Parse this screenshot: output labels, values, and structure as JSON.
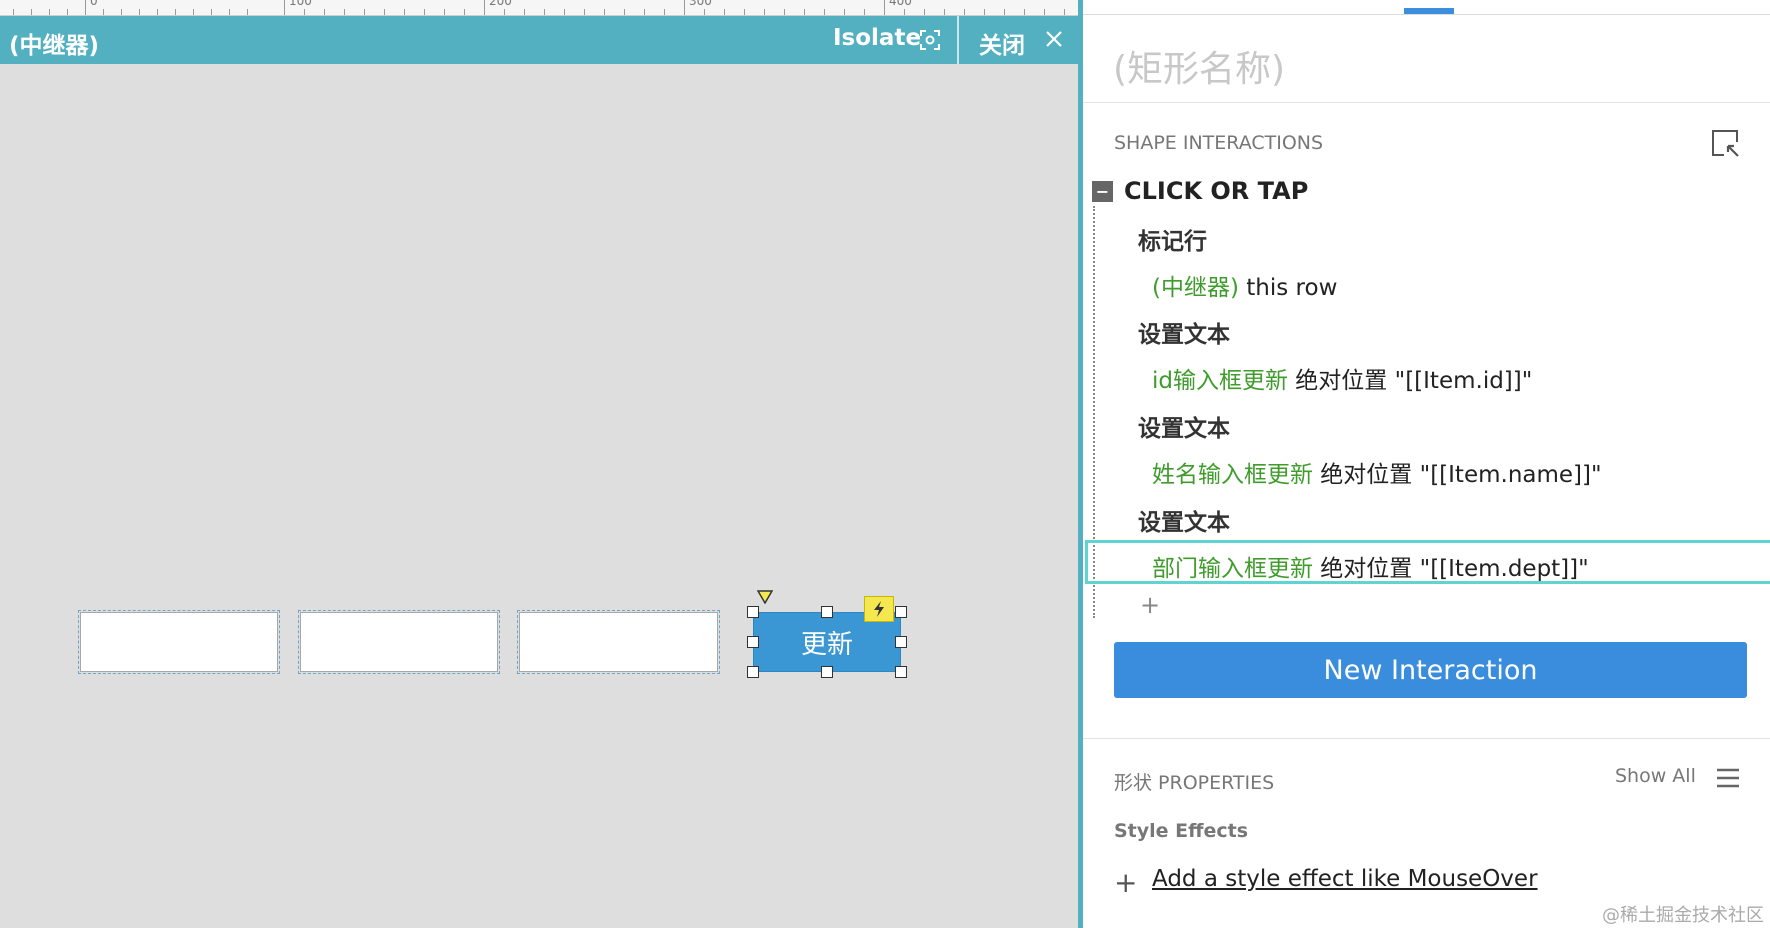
{
  "ruler": {
    "labels": [
      "0",
      "100",
      "200",
      "300",
      "400"
    ]
  },
  "repeater_bar": {
    "title": "(中继器)",
    "isolate_label": "Isolate",
    "close_label": "关闭"
  },
  "canvas": {
    "update_button_label": "更新"
  },
  "panel": {
    "shape_name": "(矩形名称)",
    "interactions_title": "SHAPE INTERACTIONS",
    "event": {
      "collapse_symbol": "−",
      "title": "CLICK OR TAP",
      "actions": [
        {
          "name": "标记行",
          "target": "(中继器)",
          "detail": " this row"
        },
        {
          "name": "设置文本",
          "target": "id输入框更新",
          "detail": " 绝对位置 \"[[Item.id]]\""
        },
        {
          "name": "设置文本",
          "target": "姓名输入框更新",
          "detail": " 绝对位置 \"[[Item.name]]\""
        },
        {
          "name": "设置文本",
          "target": "部门输入框更新",
          "detail": " 绝对位置 \"[[Item.dept]]\""
        }
      ],
      "add_symbol": "+"
    },
    "new_interaction_label": "New Interaction",
    "properties_title": "形状 PROPERTIES",
    "show_all_label": "Show All",
    "style_effects_title": "Style Effects",
    "add_effect_symbol": "+",
    "add_effect_label": "Add a style effect like MouseOver",
    "watermark": "@稀土掘金技术社区"
  }
}
